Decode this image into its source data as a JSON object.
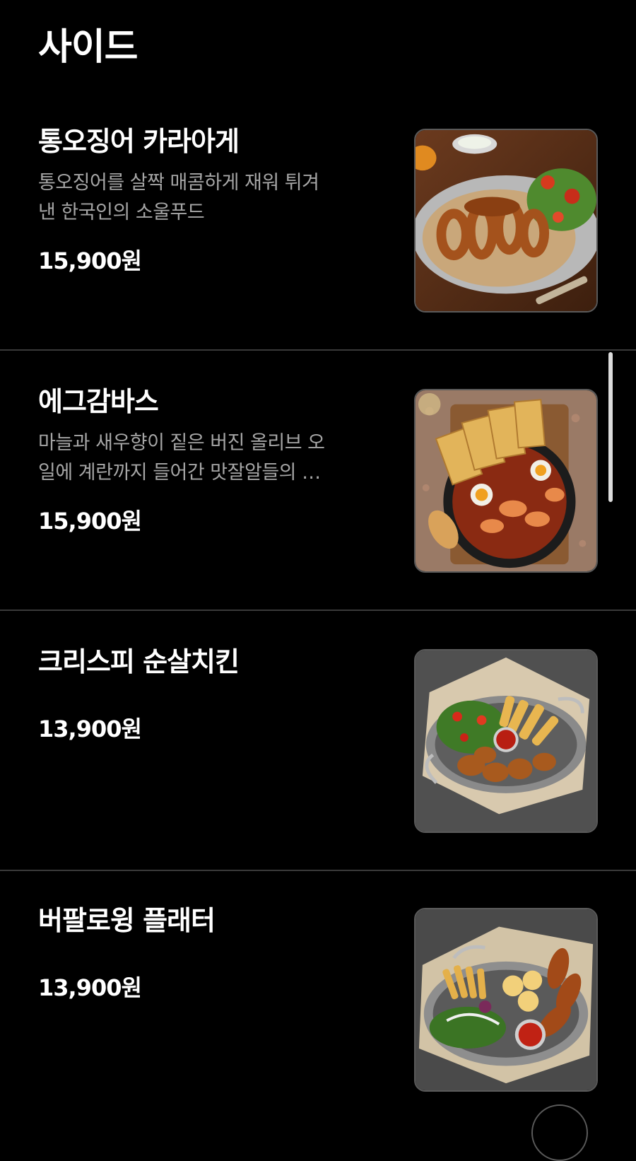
{
  "section": {
    "title": "사이드"
  },
  "menu_items": [
    {
      "name": "통오징어 카라아게",
      "description_lines": [
        "통오징어를 살짝 매콤하게 재워 튀겨",
        "낸 한국인의 소울푸드"
      ],
      "price": "15,900원",
      "photo": "fried-squid-karaage-photo"
    },
    {
      "name": "에그감바스",
      "description_lines": [
        "마늘과 새우향이 짙은 버진 올리브 오",
        "일에 계란까지 들어간 맛잘알들의 …"
      ],
      "price": "15,900원",
      "photo": "egg-gambas-photo"
    },
    {
      "name": "크리스피 순살치킨",
      "price": "13,900원",
      "photo": "crispy-boneless-chicken-photo"
    },
    {
      "name": "버팔로윙 플래터",
      "price": "13,900원",
      "photo": "buffalo-wing-platter-photo"
    }
  ],
  "colors": {
    "background": "#000000",
    "text_primary": "#ffffff",
    "text_secondary": "#a6a6a6",
    "divider": "#3a3a3a"
  }
}
